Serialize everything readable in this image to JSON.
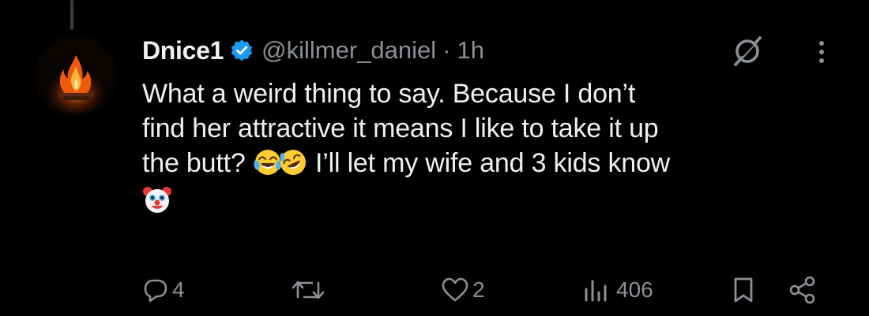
{
  "tweet": {
    "author": {
      "display_name": "Dnice1",
      "handle": "@killmer_daniel",
      "verified": true,
      "avatar_icon": "bonfire-avatar"
    },
    "separator": "·",
    "time": "1h",
    "text_lines": [
      "What a weird thing to say. Because I don’t",
      "find her attractive it means I like to take it up",
      "the butt?",
      " I’ll let my wife and 3 kids know"
    ],
    "emojis": [
      "face-with-tears-of-joy",
      "rolling-on-the-floor-laughing",
      "clown-face"
    ],
    "header_icons": [
      "grok-icon",
      "more-icon"
    ]
  },
  "actions": {
    "reply": {
      "icon": "reply-icon",
      "count": "4"
    },
    "retweet": {
      "icon": "retweet-icon",
      "count": ""
    },
    "like": {
      "icon": "like-icon",
      "count": "2"
    },
    "views": {
      "icon": "views-icon",
      "count": "406"
    },
    "bookmark": {
      "icon": "bookmark-icon"
    },
    "share": {
      "icon": "share-icon"
    }
  },
  "colors": {
    "background": "#000000",
    "text": "#e7e9ea",
    "muted": "#8b9096",
    "verified": "#1d9bf0"
  }
}
